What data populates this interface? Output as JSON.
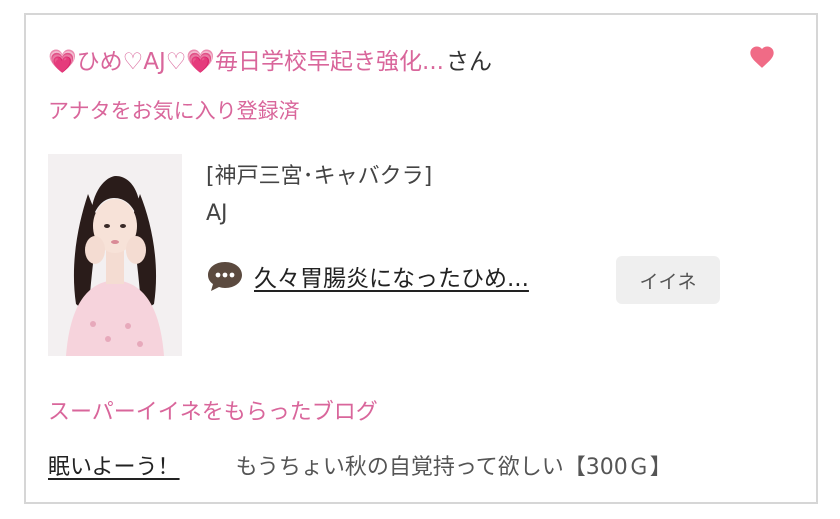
{
  "favorite": {
    "user_name": "💗ひめ♡AJ♡💗毎日学校早起き強化...",
    "suffix": "さん",
    "status": "アナタをお気に入り登録済",
    "heart_icon": "heart-icon",
    "heart_color": "#f06b86"
  },
  "cast": {
    "shop": "[神戸三宮･キャバクラ]",
    "name": "AJ",
    "latest_post": "久々胃腸炎になったひめ...",
    "comment_icon": "speech-bubble-icon",
    "like_label": "イイネ"
  },
  "super_like": {
    "heading": "スーパーイイネをもらったブログ",
    "blog_title": "眠いよーう！",
    "comment": "もうちょい秋の自覚持って欲しい【300Ｇ】"
  },
  "colors": {
    "accent_pink": "#d9669b",
    "card_border": "#d6d6d6",
    "button_bg": "#efefef"
  }
}
